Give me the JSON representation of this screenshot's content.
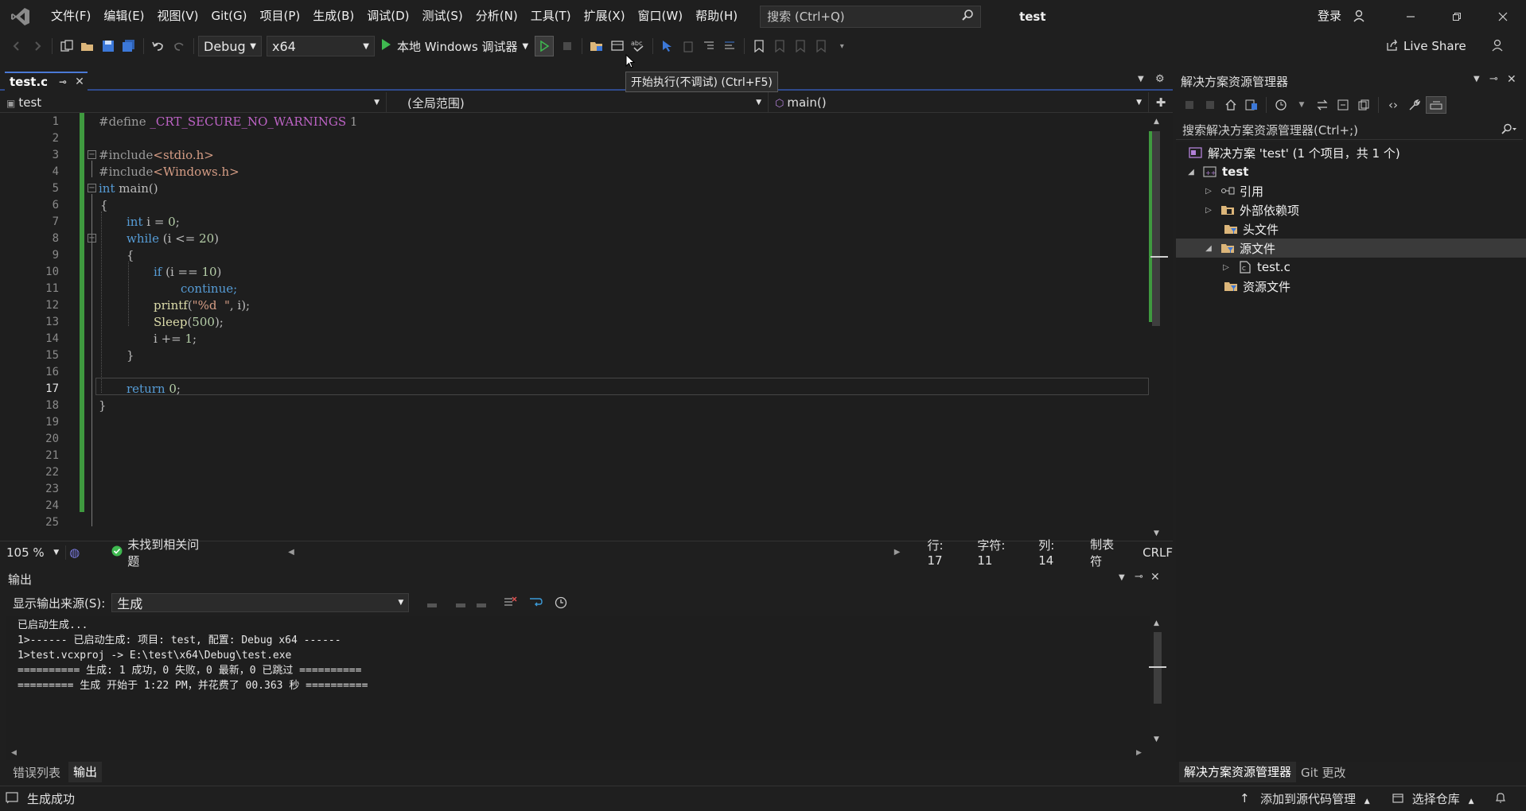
{
  "window": {
    "title": "test",
    "login_label": "登录",
    "search_placeholder": "搜索 (Ctrl+Q)"
  },
  "menu": [
    "文件(F)",
    "编辑(E)",
    "视图(V)",
    "Git(G)",
    "项目(P)",
    "生成(B)",
    "调试(D)",
    "测试(S)",
    "分析(N)",
    "工具(T)",
    "扩展(X)",
    "窗口(W)",
    "帮助(H)"
  ],
  "toolbar": {
    "config": "Debug",
    "platform": "x64",
    "debugger_label": "本地 Windows 调试器",
    "live_share": "Live Share"
  },
  "tooltip": "开始执行(不调试) (Ctrl+F5)",
  "editor": {
    "tab_label": "test.c",
    "nav_project": "test",
    "nav_scope": "(全局范围)",
    "nav_member": "main()",
    "line_numbers": [
      "1",
      "2",
      "3",
      "4",
      "5",
      "6",
      "7",
      "8",
      "9",
      "10",
      "11",
      "12",
      "13",
      "14",
      "15",
      "16",
      "17",
      "18",
      "19",
      "20",
      "21",
      "22",
      "23",
      "24",
      "25"
    ],
    "current_line": 17,
    "code": {
      "l1a": "#define ",
      "l1b": "_CRT_SECURE_NO_WARNINGS",
      "l1c": " 1",
      "l3a": "#include",
      "l3b": "<stdio.h>",
      "l4a": "#include",
      "l4b": "<Windows.h>",
      "l5a": "int",
      "l5b": " main()",
      "l6": "{",
      "l7a": "int",
      "l7b": " i = ",
      "l7c": "0",
      "l7d": ";",
      "l8a": "while",
      "l8b": " (i <= ",
      "l8c": "20",
      "l8d": ")",
      "l9": "{",
      "l10a": "if",
      "l10b": " (i == ",
      "l10c": "10",
      "l10d": ")",
      "l11": "continue;",
      "l12a": "printf",
      "l12b": "(",
      "l12c": "\"%d  \"",
      "l12d": ", i);",
      "l13a": "Sleep",
      "l13b": "(",
      "l13c": "500",
      "l13d": ");",
      "l14a": "i += ",
      "l14b": "1",
      "l14c": ";",
      "l15": "}",
      "l17a": "return",
      "l17b": " ",
      "l17c": "0",
      "l17d": ";",
      "l18": "}"
    },
    "status": {
      "zoom": "105 %",
      "issues": "未找到相关问题",
      "line": "行: 17",
      "char": "字符: 11",
      "col": "列: 14",
      "tabs": "制表符",
      "eol": "CRLF"
    }
  },
  "output": {
    "title": "输出",
    "source_label": "显示输出来源(S):",
    "source_value": "生成",
    "lines": [
      "已启动生成...",
      "1>------ 已启动生成: 项目: test, 配置: Debug x64 ------",
      "1>test.vcxproj -> E:\\test\\x64\\Debug\\test.exe",
      "========== 生成: 1 成功，0 失败，0 最新，0 已跳过 ==========",
      "========= 生成 开始于 1:22 PM，并花费了 00.363 秒 =========="
    ],
    "tabs": [
      "错误列表",
      "输出"
    ]
  },
  "solution_explorer": {
    "title": "解决方案资源管理器",
    "search_placeholder": "搜索解决方案资源管理器(Ctrl+;)",
    "items": [
      {
        "label": "解决方案 'test' (1 个项目，共 1 个)"
      },
      {
        "label": "test"
      },
      {
        "label": "引用"
      },
      {
        "label": "外部依赖项"
      },
      {
        "label": "头文件"
      },
      {
        "label": "源文件"
      },
      {
        "label": "test.c"
      },
      {
        "label": "资源文件"
      }
    ],
    "tabs": [
      "解决方案资源管理器",
      "Git 更改"
    ]
  },
  "statusbar": {
    "message": "生成成功",
    "add_source": "添加到源代码管理",
    "select_repo": "选择仓库"
  },
  "colors": {
    "accent": "#4a79d6",
    "change_bar": "#3f9a3f",
    "run_green": "#3fb950"
  }
}
